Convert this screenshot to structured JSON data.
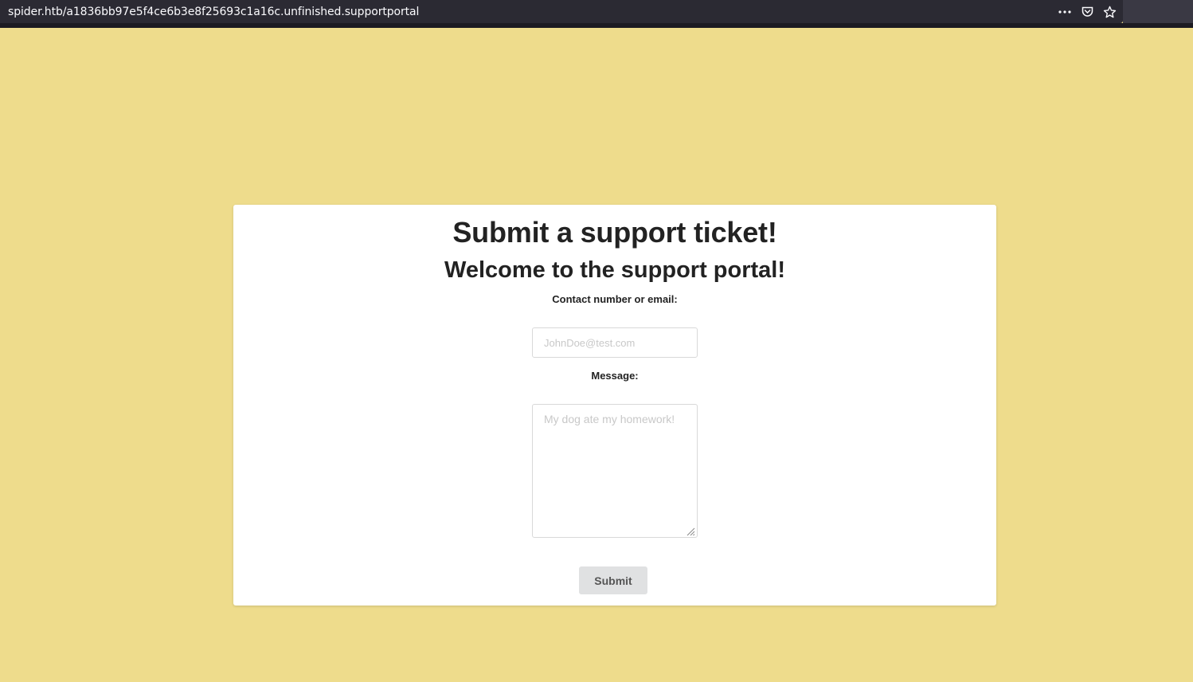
{
  "browser": {
    "url": "spider.htb/a1836bb97e5f4ce6b3e8f25693c1a16c.unfinished.supportportal",
    "icons": [
      "more-icon",
      "pocket-icon",
      "bookmark-star-icon"
    ]
  },
  "page": {
    "title": "Submit a support ticket!",
    "subtitle": "Welcome to the support portal!",
    "contact_label": "Contact number or email:",
    "contact_placeholder": "JohnDoe@test.com",
    "contact_value": "",
    "message_label": "Message:",
    "message_placeholder": "My dog ate my homework!",
    "message_value": "",
    "submit_label": "Submit"
  },
  "colors": {
    "background": "#eedc8c",
    "card": "#ffffff",
    "url_bar": "#2b2a33",
    "button": "#e0e1e2"
  }
}
